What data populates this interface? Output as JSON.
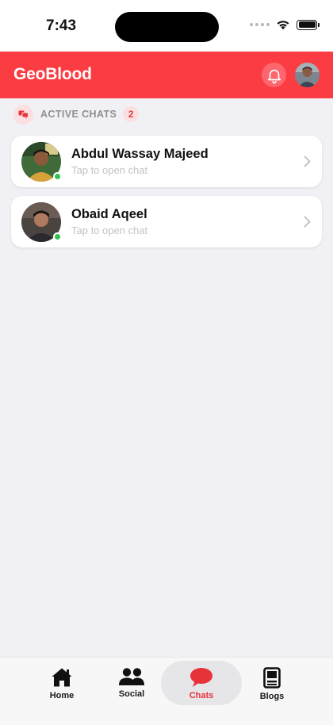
{
  "status_bar": {
    "time": "7:43"
  },
  "header": {
    "title": "GeoBlood",
    "bell_icon": "bell-icon",
    "avatar": "profile-avatar"
  },
  "colors": {
    "brand_red": "#fc3c43",
    "online_green": "#2fc450",
    "active_tab_red": "#e8323a"
  },
  "section": {
    "label": "ACTIVE CHATS",
    "count": "2",
    "icon": "chat-bubbles-icon"
  },
  "chats": [
    {
      "name": "Abdul Wassay Majeed",
      "subtitle": "Tap to open chat",
      "online": true
    },
    {
      "name": "Obaid Aqeel",
      "subtitle": "Tap to open chat",
      "online": true
    }
  ],
  "tabs": [
    {
      "label": "Home",
      "icon": "home-icon",
      "active": false
    },
    {
      "label": "Social",
      "icon": "people-icon",
      "active": false
    },
    {
      "label": "Chats",
      "icon": "chat-bubble-icon",
      "active": true
    },
    {
      "label": "Blogs",
      "icon": "book-icon",
      "active": false
    }
  ]
}
